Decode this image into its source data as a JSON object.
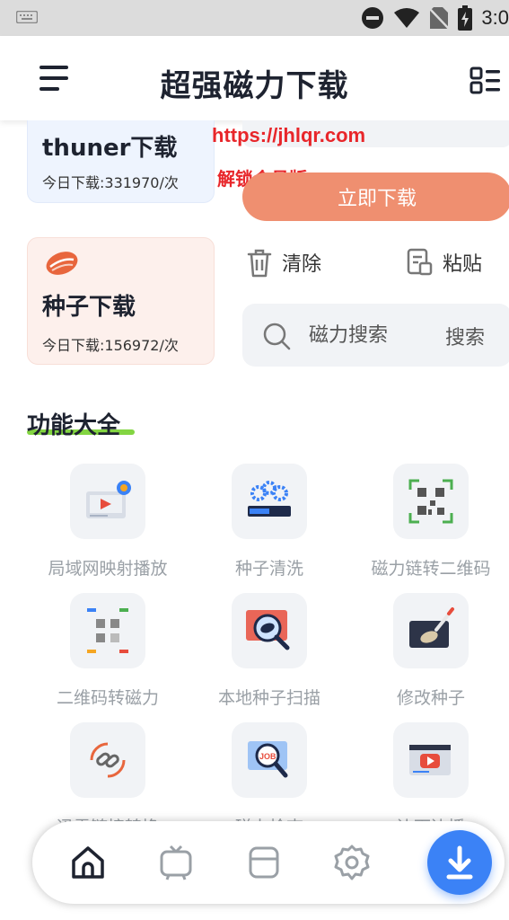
{
  "status_bar": {
    "time": "3:0"
  },
  "header": {
    "title": "超强磁力下载"
  },
  "cards": {
    "thunder": {
      "title": "thuner下载",
      "subtitle": "今日下载:331970/次"
    },
    "seed": {
      "title": "种子下载",
      "subtitle": "今日下载:156972/次"
    }
  },
  "watermark": {
    "url": "https://jhlqr.com",
    "note": "解锁会员版"
  },
  "actions": {
    "download_label": "立即下载",
    "clear_label": "清除",
    "paste_label": "粘贴"
  },
  "search": {
    "placeholder": "磁力搜索",
    "button_label": "搜索"
  },
  "section": {
    "title": "功能大全"
  },
  "features": [
    {
      "label": "局域网映射播放",
      "icon": "cast-play-icon"
    },
    {
      "label": "种子清洗",
      "icon": "gears-icon"
    },
    {
      "label": "磁力链转二维码",
      "icon": "qr-code-icon"
    },
    {
      "label": "二维码转磁力",
      "icon": "qr-scan-icon"
    },
    {
      "label": "本地种子扫描",
      "icon": "magnifier-seed-icon"
    },
    {
      "label": "修改种子",
      "icon": "edit-seed-icon"
    },
    {
      "label": "迅雷链接转换",
      "icon": "link-convert-icon"
    },
    {
      "label": "磁力检查",
      "icon": "job-check-icon"
    },
    {
      "label": "边下边播",
      "icon": "video-play-icon"
    }
  ],
  "bottom_nav": [
    "home-icon",
    "tv-icon",
    "cards-icon",
    "settings-icon",
    "download-icon"
  ],
  "colors": {
    "accent_orange": "#ef8f70",
    "watermark_red": "#e8262a",
    "fab_blue": "#3b82f6",
    "underline_green": "#76d02e"
  }
}
